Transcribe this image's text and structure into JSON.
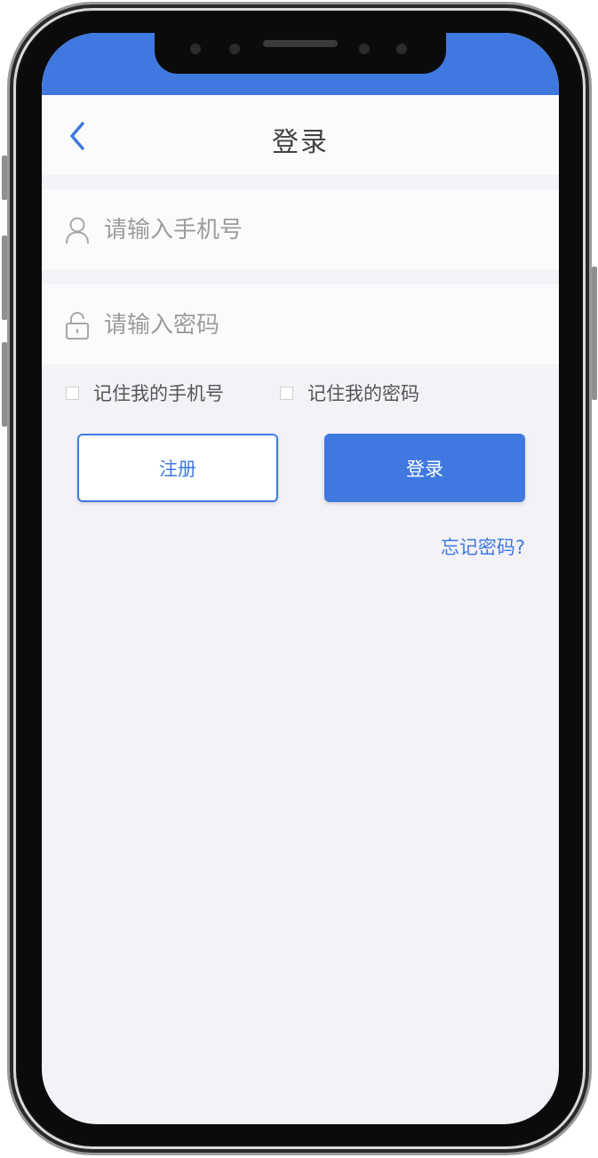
{
  "header": {
    "title": "登录",
    "back_icon": "chevron-left-icon"
  },
  "form": {
    "phone": {
      "placeholder": "请输入手机号",
      "value": "",
      "icon": "user-icon"
    },
    "password": {
      "placeholder": "请输入密码",
      "value": "",
      "icon": "lock-icon"
    },
    "remember_phone": {
      "label": "记住我的手机号",
      "checked": false
    },
    "remember_password": {
      "label": "记住我的密码",
      "checked": false
    }
  },
  "actions": {
    "register_label": "注册",
    "login_label": "登录",
    "forgot_label": "忘记密码?"
  },
  "colors": {
    "accent": "#3f79e0",
    "background": "#f3f2f7"
  }
}
